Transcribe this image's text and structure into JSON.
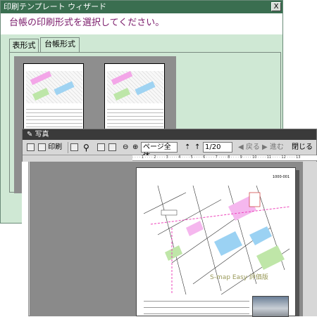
{
  "wizard": {
    "title": "印刷テンプレート ウィザード",
    "close_label": "X",
    "instruction": "台帳の印刷形式を選択してください。",
    "tabs": [
      {
        "label": "表形式"
      },
      {
        "label": "台帳形式"
      }
    ]
  },
  "viewer": {
    "title": "写真",
    "toolbar": {
      "print_label": "印刷",
      "zoom_value": "ページ全体",
      "page_value": "1/20",
      "back_label": "戻る",
      "forward_label": "進む",
      "close_label": "閉じる"
    },
    "document": {
      "page_label": "1000-001",
      "watermark": "S-map Easy 評価版"
    }
  },
  "colors": {
    "wizard_bg": "#cfe8d4",
    "wizard_title": "#3a6e50",
    "instruction_text": "#7a1a6a"
  }
}
